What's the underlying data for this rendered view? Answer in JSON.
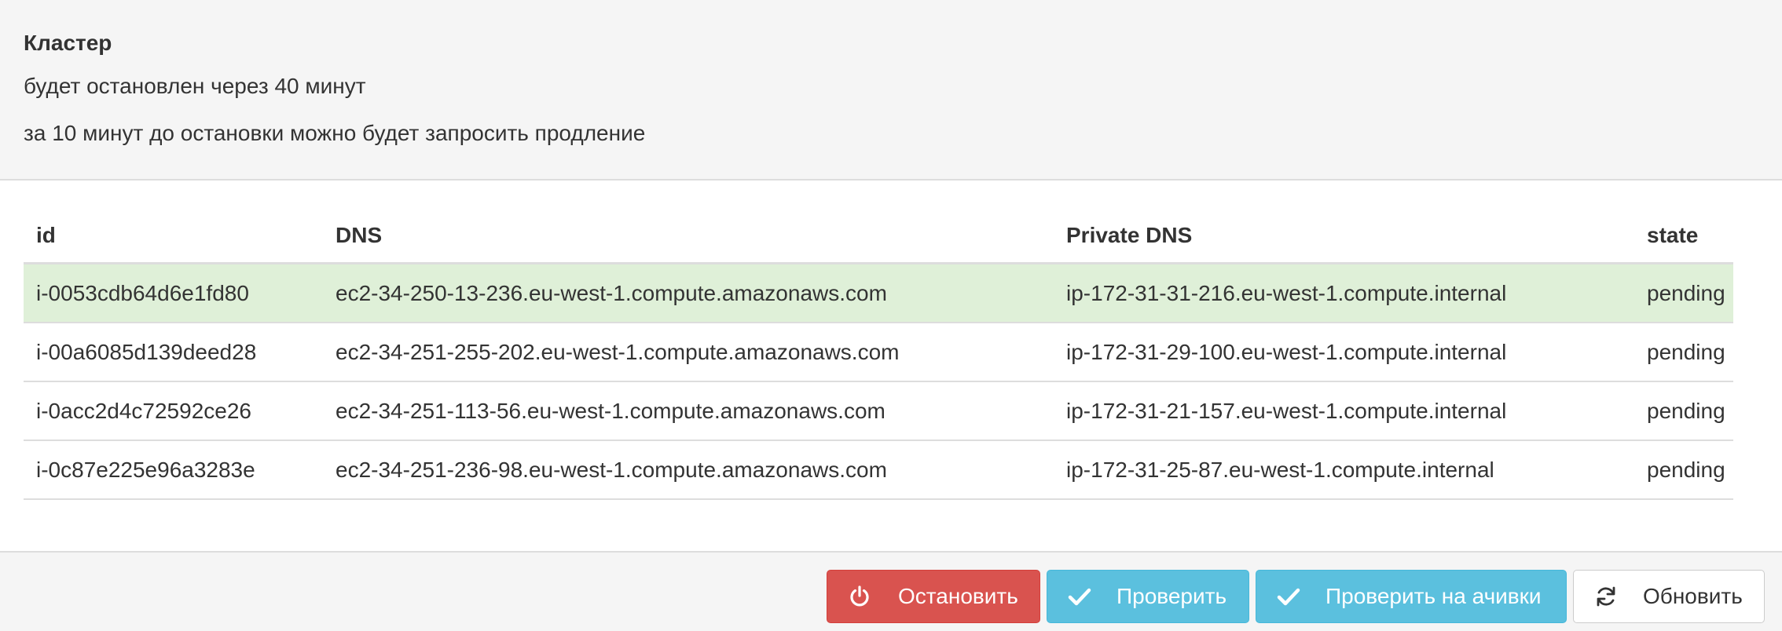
{
  "cluster": {
    "title": "Кластер",
    "stop_info": "будет остановлен через 40 минут",
    "extend_info": "за 10 минут до остановки можно будет запросить продление"
  },
  "table": {
    "headers": [
      "id",
      "DNS",
      "Private DNS",
      "state"
    ],
    "rows": [
      {
        "id": "i-0053cdb64d6e1fd80",
        "dns": "ec2-34-250-13-236.eu-west-1.compute.amazonaws.com",
        "private_dns": "ip-172-31-31-216.eu-west-1.compute.internal",
        "state": "pending"
      },
      {
        "id": "i-00a6085d139deed28",
        "dns": "ec2-34-251-255-202.eu-west-1.compute.amazonaws.com",
        "private_dns": "ip-172-31-29-100.eu-west-1.compute.internal",
        "state": "pending"
      },
      {
        "id": "i-0acc2d4c72592ce26",
        "dns": "ec2-34-251-113-56.eu-west-1.compute.amazonaws.com",
        "private_dns": "ip-172-31-21-157.eu-west-1.compute.internal",
        "state": "pending"
      },
      {
        "id": "i-0c87e225e96a3283e",
        "dns": "ec2-34-251-236-98.eu-west-1.compute.amazonaws.com",
        "private_dns": "ip-172-31-25-87.eu-west-1.compute.internal",
        "state": "pending"
      }
    ]
  },
  "buttons": {
    "stop": {
      "label": "Остановить",
      "icon": "power-icon"
    },
    "check": {
      "label": "Проверить",
      "icon": "check-icon"
    },
    "check_achievements": {
      "label": "Проверить на ачивки",
      "icon": "check-icon"
    },
    "refresh": {
      "label": "Обновить",
      "icon": "refresh-icon"
    }
  },
  "colors": {
    "danger": "#d9534f",
    "info": "#5bc0de",
    "success_row": "#dff0d8",
    "panel_bg": "#f5f5f5",
    "border": "#dddddd"
  }
}
